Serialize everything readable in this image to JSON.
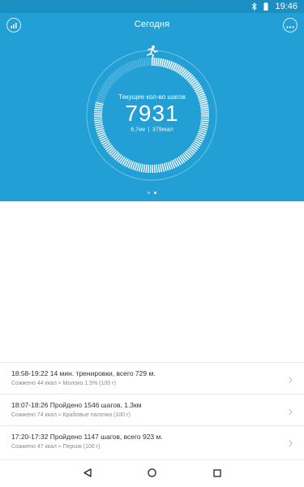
{
  "status_bar": {
    "time": "19:46",
    "icons": [
      "bluetooth-icon",
      "battery-icon"
    ]
  },
  "header": {
    "title": "Сегодня",
    "left_button_icon": "bar-chart-icon",
    "right_button_icon": "more-icon"
  },
  "progress": {
    "label": "Текущее кол-во шагов",
    "steps": "7931",
    "distance": "6,7км",
    "calories": "379ккал",
    "goal_fraction": 0.79,
    "top_icon": "running-person-icon"
  },
  "pager": {
    "count": 2,
    "active_index": 1
  },
  "activities": [
    {
      "title": "18:58-19:22  14 мин. тренировки,  всего 729 м.",
      "detail": "Сожжено 44 ккал ≈ Молоко 1.5% (100 г)"
    },
    {
      "title": "18:07-18:26  Пройдено 1546 шагов, 1.3км",
      "detail": "Сожжено 74 ккал ≈ Крабовые палочки (100 г)"
    },
    {
      "title": "17:20-17:32  Пройдено 1147 шагов,  всего 923 м.",
      "detail": "Сожжено 47 ккал ≈ Персик (100 г)"
    }
  ],
  "nav": {
    "icons": [
      "back-icon",
      "home-icon",
      "recents-icon"
    ]
  },
  "colors": {
    "hero": "#22a0d6",
    "status_bar": "#1b8fc1"
  }
}
